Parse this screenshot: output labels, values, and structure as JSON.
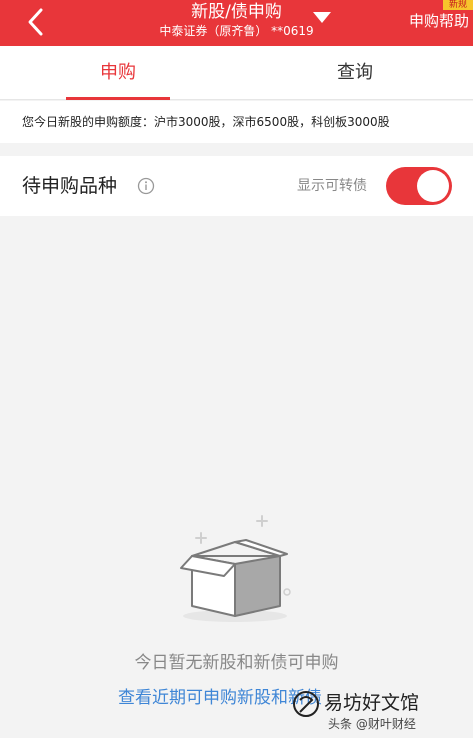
{
  "header": {
    "title": "新股/债申购",
    "subtitle": "中泰证券（原齐鲁） **0619",
    "help_label": "申购帮助",
    "badge": "新规"
  },
  "tabs": [
    {
      "label": "申购",
      "active": true
    },
    {
      "label": "查询",
      "active": false
    }
  ],
  "quota": {
    "text": "您今日新股的申购额度：沪市3000股，深市6500股，科创板3000股"
  },
  "section": {
    "title": "待申购品种",
    "toggle_label": "显示可转债",
    "toggle_on": true
  },
  "empty": {
    "message": "今日暂无新股和新债可申购",
    "link": "查看近期可申购新股和新债"
  },
  "watermark": {
    "main": "易坊好文馆",
    "sub": "头条 @财叶财经"
  },
  "colors": {
    "accent": "#e8363a",
    "link": "#3f86d6"
  },
  "icons": [
    "back-arrow-icon",
    "dropdown-caret-icon",
    "info-icon",
    "empty-box-icon"
  ]
}
